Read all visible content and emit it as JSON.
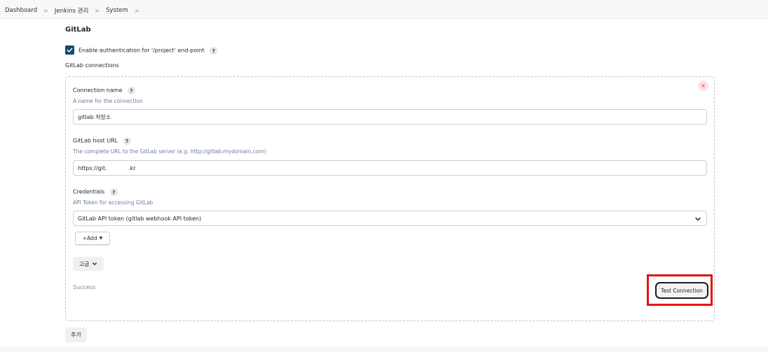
{
  "breadcrumb": {
    "items": [
      "Dashboard",
      "Jenkins 관리",
      "System"
    ],
    "separator": ">"
  },
  "section": {
    "title": "GitLab",
    "auth_checkbox": {
      "label": "Enable authentication for '/project' end-point",
      "checked": true
    },
    "connections_heading": "GitLab connections"
  },
  "connection": {
    "close_symbol": "×",
    "name": {
      "label": "Connection name",
      "description": "A name for the connection",
      "value": "gitlab 저장소"
    },
    "host": {
      "label": "GitLab host URL",
      "description": "The complete URL to the GitLab server (e.g. http://gitlab.mydomain.com)",
      "value": "https://git.            .kr"
    },
    "credentials": {
      "label": "Credentials",
      "description": "API Token for accessing GitLab",
      "selected": "GitLab API token (gitlab webhook API token)",
      "add_label": "Add"
    },
    "advanced_label": "고급",
    "status": "Success",
    "test_button_label": "Test Connection"
  },
  "add_button_label": "추가",
  "help_symbol": "?",
  "colors": {
    "checkbox": "#124a6e",
    "description": "#6a7da0",
    "highlight": "#e31414",
    "close": "#d33333"
  }
}
